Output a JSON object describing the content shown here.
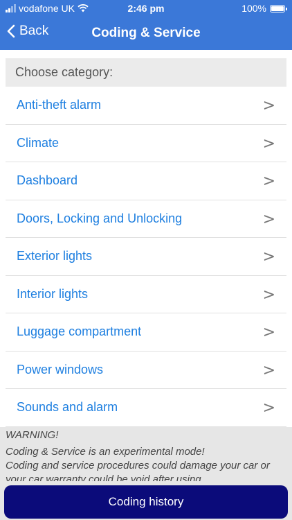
{
  "status_bar": {
    "carrier": "vodafone UK",
    "time": "2:46 pm",
    "battery": "100%"
  },
  "nav": {
    "back_label": "Back",
    "title": "Coding & Service"
  },
  "section": {
    "header": "Choose category:"
  },
  "categories": [
    {
      "label": "Anti-theft alarm",
      "arrow": ">"
    },
    {
      "label": "Climate",
      "arrow": ">"
    },
    {
      "label": "Dashboard",
      "arrow": ">"
    },
    {
      "label": "Doors, Locking and Unlocking",
      "arrow": ">"
    },
    {
      "label": "Exterior lights",
      "arrow": ">"
    },
    {
      "label": "Interior lights",
      "arrow": ">"
    },
    {
      "label": "Luggage compartment",
      "arrow": ">"
    },
    {
      "label": "Power windows",
      "arrow": ">"
    },
    {
      "label": "Sounds and alarm",
      "arrow": ">"
    }
  ],
  "warning": {
    "title": "WARNING!",
    "line1": "Coding & Service is an experimental mode!",
    "line2": "Coding and service procedures could damage your car or your car warranty could be void after using"
  },
  "footer": {
    "history_button": "Coding history"
  },
  "colors": {
    "nav_bar": "#3b78d8",
    "link_text": "#1e7fe0",
    "button": "#0b0b7a"
  }
}
